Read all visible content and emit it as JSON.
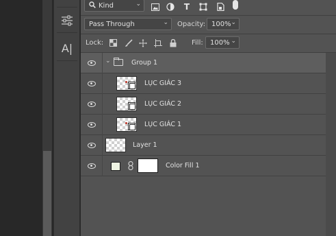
{
  "filter": {
    "kind_label": "Kind",
    "icons": [
      "image-filter-icon",
      "adjustment-filter-icon",
      "type-filter-icon",
      "shape-filter-icon",
      "smart-object-filter-icon"
    ]
  },
  "blend": {
    "mode": "Pass Through",
    "opacity_label": "Opacity:",
    "opacity_value": "100%"
  },
  "lock": {
    "label": "Lock:",
    "fill_label": "Fill:",
    "fill_value": "100%"
  },
  "tools": {
    "character_label": "A|"
  },
  "layers": [
    {
      "name": "Group 1",
      "type": "group"
    },
    {
      "name": "LỤC GIÁC 3",
      "type": "shape"
    },
    {
      "name": "LỤC GIÁC 2",
      "type": "shape"
    },
    {
      "name": "LỤC GIÁC 1",
      "type": "shape"
    },
    {
      "name": "Layer 1",
      "type": "pixel"
    },
    {
      "name": "Color Fill 1",
      "type": "fill",
      "swatch_color": "#eef3e2"
    }
  ]
}
